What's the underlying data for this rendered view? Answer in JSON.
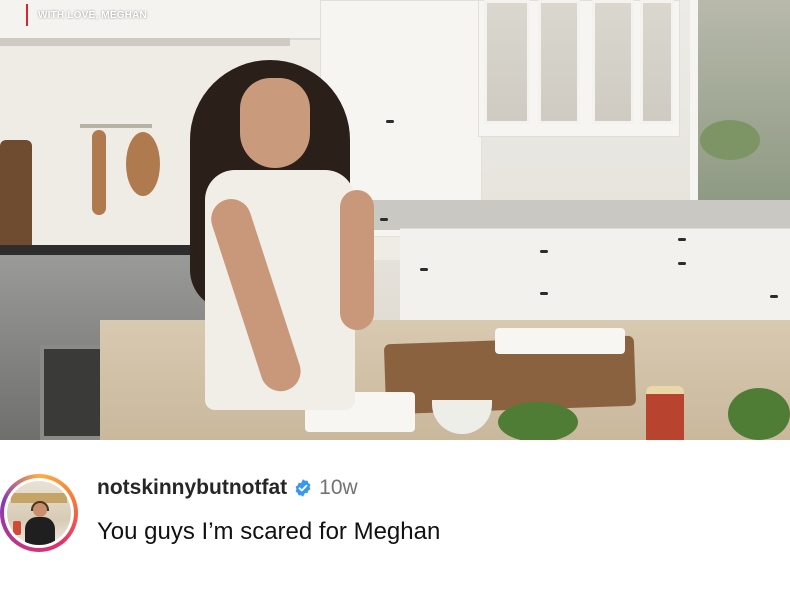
{
  "video": {
    "watermark_text": "WITH LOVE, MEGHAN",
    "accent_color": "#d9232e"
  },
  "comment": {
    "username": "notskinnybutnotfat",
    "verified": true,
    "verified_icon": "verified-badge-icon",
    "verified_color": "#3897f0",
    "time_ago": "10w",
    "text": "You guys I’m scared for Meghan",
    "avatar_ring_colors": [
      "#fcaf45",
      "#f77737",
      "#e1306c",
      "#c13584",
      "#833ab4"
    ]
  }
}
